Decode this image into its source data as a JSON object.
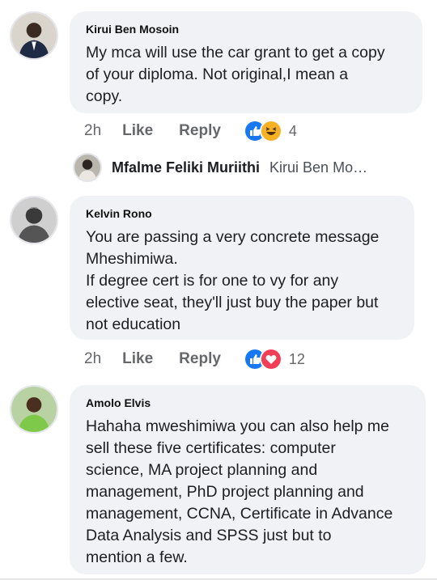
{
  "comments": [
    {
      "author": "Kirui Ben Mosoin",
      "text": "My mca will use the car grant to get a copy\nof your diploma. Not original,I mean a\ncopy.",
      "time": "2h",
      "like_label": "Like",
      "reply_label": "Reply",
      "reactions": [
        "like-icon",
        "haha-icon"
      ],
      "reaction_count": "4"
    },
    {
      "author": "Kelvin Rono",
      "text": "You are passing a very concrete message\nMheshimiwa.\nIf degree cert is for one to vy for any\nelective seat, they'll just buy the paper but\nnot education",
      "time": "2h",
      "like_label": "Like",
      "reply_label": "Reply",
      "reactions": [
        "like-icon",
        "love-icon"
      ],
      "reaction_count": "12"
    },
    {
      "author": "Amolo Elvis",
      "text": "Hahaha mweshimiwa you can also help me\nsell these five certificates: computer\nscience, MA project planning and\nmanagement, PhD project planning and\nmanagement, CCNA, Certificate in Advance\nData Analysis and SPSS just but to\nmention a few."
    }
  ],
  "reply_preview": {
    "author": "Mfalme Feliki Muriithi",
    "text": "Kirui Ben Mo…"
  },
  "colors": {
    "bubble": "#f0f2f5",
    "like_blue": "#1877f2",
    "love_red": "#f33e58",
    "haha_yellow": "#f7b125",
    "meta_gray": "#65676b"
  }
}
